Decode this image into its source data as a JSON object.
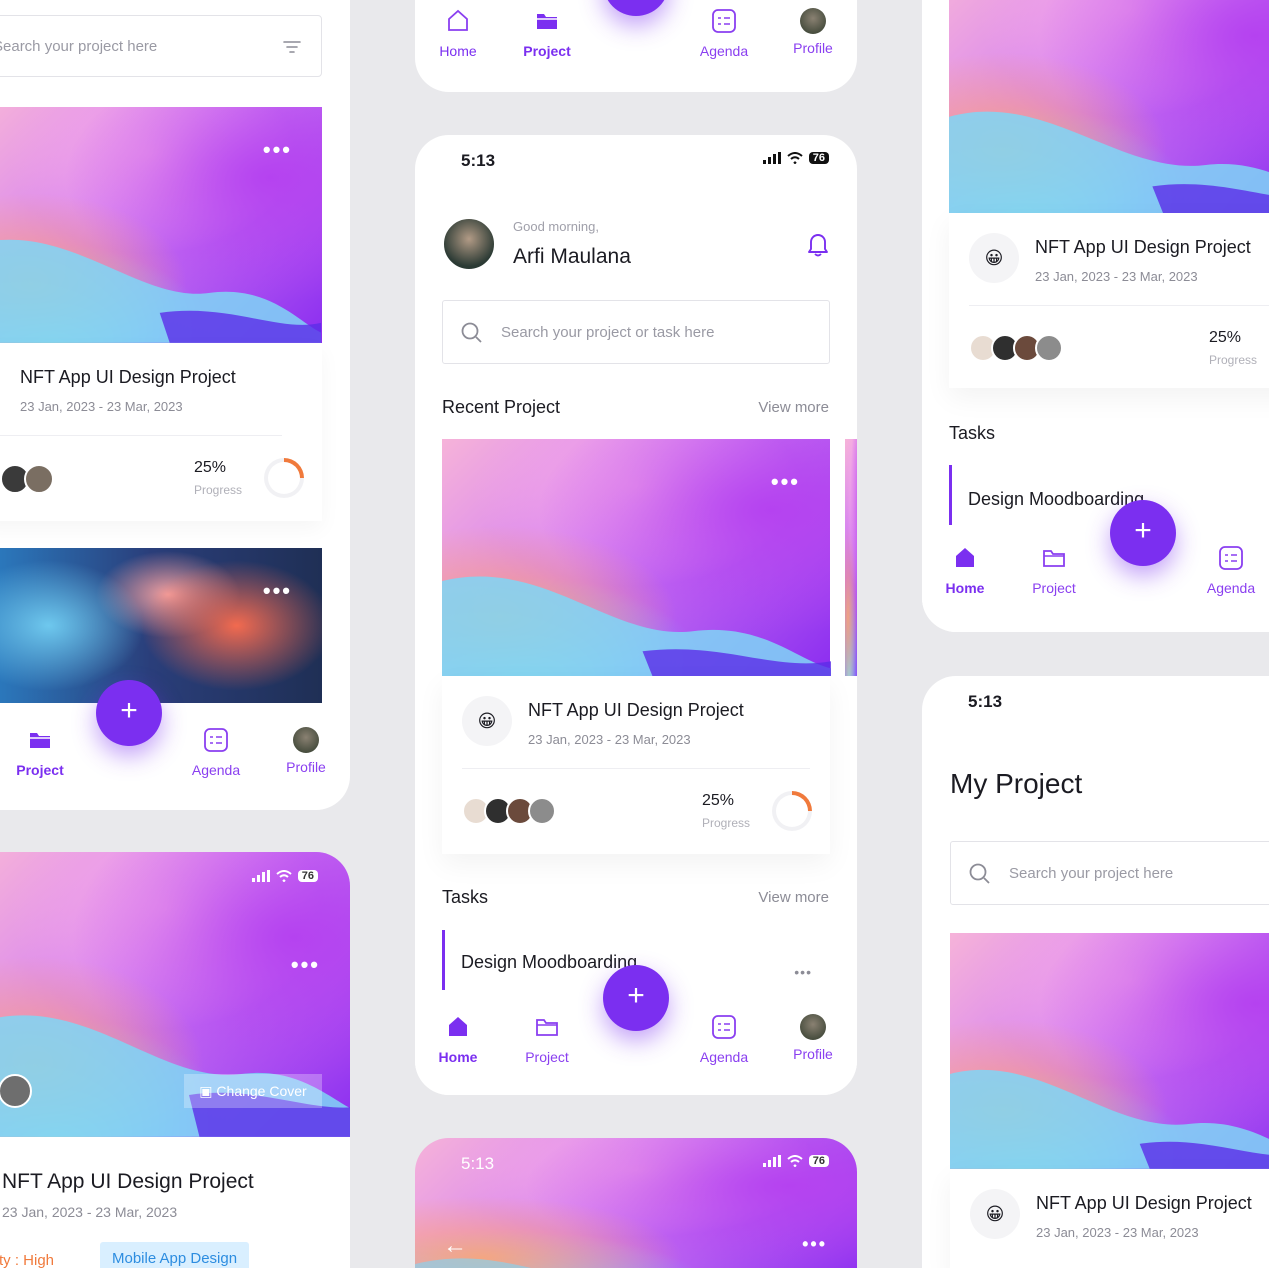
{
  "colors": {
    "accent": "#7b2ff0",
    "bg": "#e9e9ec",
    "orange": "#f07a3c"
  },
  "nav": {
    "home": "Home",
    "project": "Project",
    "agenda": "Agenda",
    "profile": "Profile",
    "fab": "+"
  },
  "left": {
    "search_placeholder": "Search your project here",
    "card1": {
      "title": "NFT App UI Design Project",
      "dates": "23 Jan, 2023 - 23 Mar, 2023",
      "percent": "25%",
      "progress_label": "Progress",
      "progress": 0.25
    },
    "card_menu": "•••",
    "cover": {
      "change_cover": "Change Cover",
      "title": "NFT App UI Design Project",
      "dates": "23 Jan, 2023 - 23 Mar, 2023",
      "priority": "Priority : High",
      "tag": "Mobile App Design",
      "signal": "76"
    }
  },
  "center": {
    "time": "5:13",
    "battery": "76",
    "greeting": "Good morning,",
    "user_name": "Arfi Maulana",
    "search_placeholder": "Search your project or task here",
    "recent_title": "Recent Project",
    "view_more": "View more",
    "project": {
      "title": "NFT App UI Design Project",
      "dates": "23 Jan, 2023 - 23 Mar, 2023",
      "percent": "25%",
      "progress_label": "Progress",
      "progress": 0.25,
      "emoji": "😀"
    },
    "tasks_title": "Tasks",
    "task": {
      "title": "Design Moodboarding",
      "menu": "•••"
    },
    "bottom_time": "5:13",
    "back_arrow": "←"
  },
  "right": {
    "project": {
      "title": "NFT App UI Design Project",
      "dates": "23 Jan, 2023 - 23 Mar, 2023",
      "percent": "25%",
      "progress_label": "Progress",
      "emoji": "😀"
    },
    "tasks_title": "Tasks",
    "task_title": "Design Moodboarding",
    "time": "5:13",
    "page_title": "My Project",
    "search_placeholder": "Search your project here",
    "project2": {
      "title": "NFT App UI Design Project",
      "dates": "23 Jan, 2023 - 23 Mar, 2023",
      "emoji": "😀"
    }
  }
}
